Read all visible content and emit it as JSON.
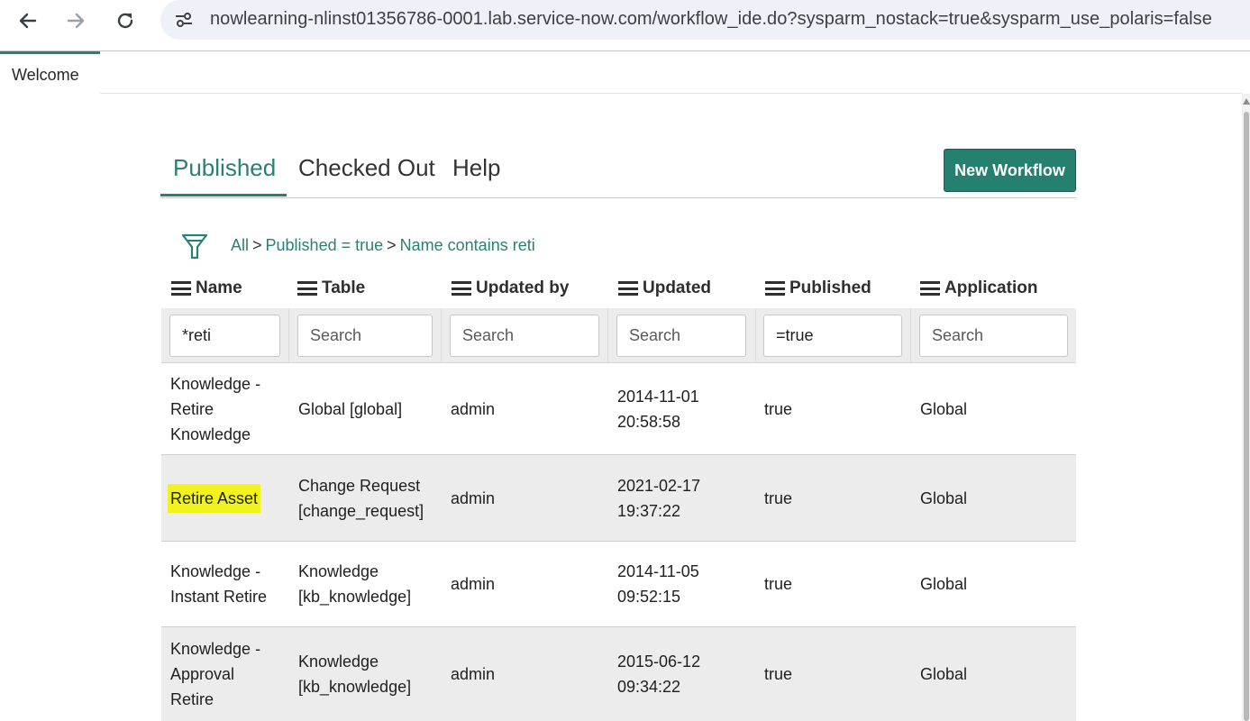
{
  "browser": {
    "url": "nowlearning-nlinst01356786-0001.lab.service-now.com/workflow_ide.do?sysparm_nostack=true&sysparm_use_polaris=false",
    "icons": [
      "back-arrow-icon",
      "forward-arrow-icon",
      "reload-icon",
      "site-info-icon"
    ]
  },
  "app_tabs": [
    {
      "label": "Welcome"
    }
  ],
  "workflow_tabs": [
    {
      "label": "Published",
      "active": true
    },
    {
      "label": "Checked Out",
      "active": false
    },
    {
      "label": "Help",
      "active": false
    }
  ],
  "new_workflow_label": "New Workflow",
  "breadcrumb": {
    "icon": "filter-funnel-icon",
    "items": [
      "All",
      "Published = true",
      "Name contains reti"
    ],
    "separator": ">"
  },
  "table": {
    "columns": [
      "Name",
      "Table",
      "Updated by",
      "Updated",
      "Published",
      "Application"
    ],
    "filters": [
      {
        "value": "*reti",
        "placeholder": "Search"
      },
      {
        "value": "",
        "placeholder": "Search"
      },
      {
        "value": "",
        "placeholder": "Search"
      },
      {
        "value": "",
        "placeholder": "Search"
      },
      {
        "value": "=true",
        "placeholder": "Search"
      },
      {
        "value": "",
        "placeholder": "Search"
      }
    ],
    "rows": [
      {
        "name": [
          "Knowledge -",
          "Retire",
          "Knowledge"
        ],
        "table": [
          "Global [global]"
        ],
        "updated_by": [
          "admin"
        ],
        "updated": [
          "2014-11-01",
          "20:58:58"
        ],
        "published": [
          "true"
        ],
        "application": [
          "Global"
        ]
      },
      {
        "name": [
          "Retire Asset"
        ],
        "table": [
          "Change Request",
          "[change_request]"
        ],
        "updated_by": [
          "admin"
        ],
        "updated": [
          "2021-02-17",
          "19:37:22"
        ],
        "published": [
          "true"
        ],
        "application": [
          "Global"
        ],
        "highlighted": true
      },
      {
        "name": [
          "Knowledge -",
          "Instant Retire"
        ],
        "table": [
          "Knowledge",
          "[kb_knowledge]"
        ],
        "updated_by": [
          "admin"
        ],
        "updated": [
          "2014-11-05",
          "09:52:15"
        ],
        "published": [
          "true"
        ],
        "application": [
          "Global"
        ]
      },
      {
        "name": [
          "Knowledge -",
          "Approval",
          "Retire"
        ],
        "table": [
          "Knowledge",
          "[kb_knowledge]"
        ],
        "updated_by": [
          "admin"
        ],
        "updated": [
          "2015-06-12",
          "09:34:22"
        ],
        "published": [
          "true"
        ],
        "application": [
          "Global"
        ]
      }
    ]
  },
  "colors": {
    "accent": "#2b8073",
    "button": "#25806f",
    "highlight": "#f2f21c",
    "row_shade": "#ececec"
  }
}
